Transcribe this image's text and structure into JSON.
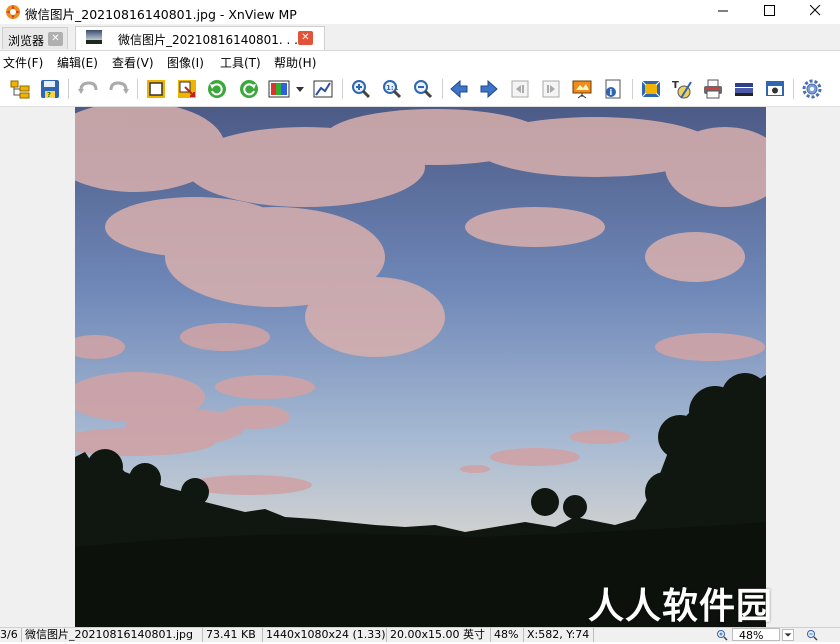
{
  "window": {
    "title": "微信图片_20210816140801.jpg - XnView MP",
    "app_icon": "xnview-icon",
    "controls": [
      "minimize-icon",
      "maximize-icon",
      "close-icon"
    ]
  },
  "tabs": [
    {
      "label": "浏览器",
      "close_color": "#b0b0b0",
      "active": false
    },
    {
      "label": "微信图片_20210816140801. . . .",
      "close_color": "#e2543a",
      "active": true
    }
  ],
  "menu": [
    {
      "label": "文件(F)"
    },
    {
      "label": "编辑(E)"
    },
    {
      "label": "查看(V)"
    },
    {
      "label": "图像(I)"
    },
    {
      "label": "工具(T)"
    },
    {
      "label": "帮助(H)"
    }
  ],
  "toolbar": {
    "icons": [
      "browser-icon",
      "save-icon",
      "undo-icon",
      "redo-icon",
      "crop-icon",
      "resize-icon",
      "rotate-left-icon",
      "rotate-right-icon",
      "color-adjust-icon",
      "levels-icon",
      "zoom-in-icon",
      "zoom-actual-icon",
      "zoom-out-icon",
      "previous-icon",
      "next-icon",
      "first-page-icon",
      "last-page-icon",
      "slideshow-icon",
      "properties-icon",
      "fullscreen-icon",
      "edit-icon",
      "print-icon",
      "scanner-icon",
      "capture-icon",
      "settings-icon"
    ]
  },
  "watermark": "人人软件园",
  "status": {
    "index": "3/6",
    "filename": "微信图片_20210816140801.jpg",
    "filesize": "73.41 KB",
    "dimensions": "1440x1080x24 (1.33)",
    "print_size": "20.00x15.00 英寸",
    "zoom": "48%",
    "coords": "X:582, Y:74",
    "zoom_field": "48%"
  },
  "colors": {
    "sky_top": "#4d5f8c",
    "sky_bottom": "#c5d0dc",
    "cloud": "#d8b0ac",
    "tab_close_active": "#e2543a"
  }
}
